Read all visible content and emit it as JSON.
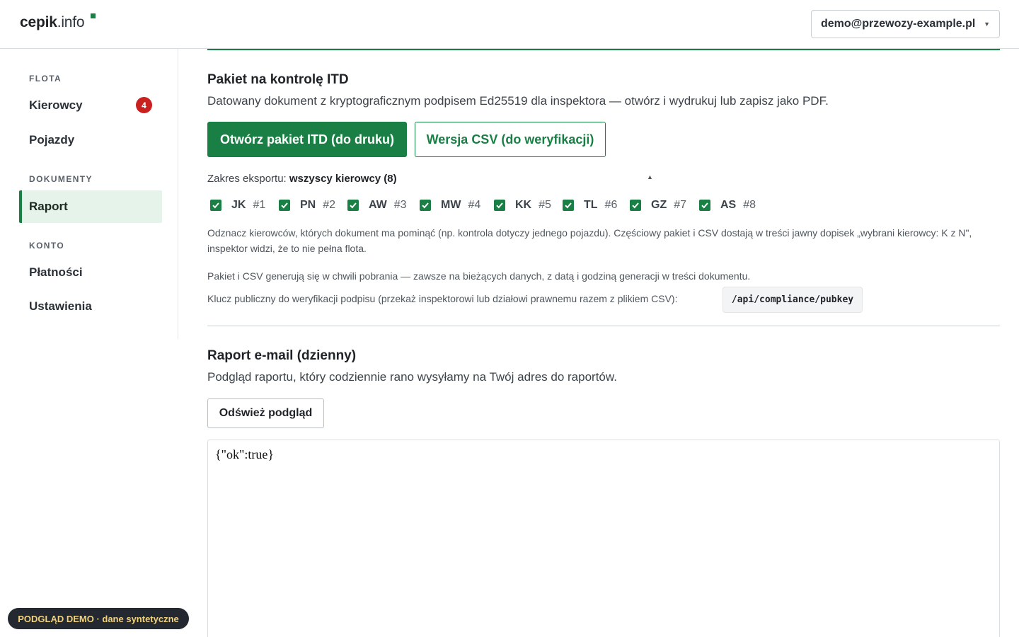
{
  "header": {
    "logo_name": "cepik",
    "logo_tld": ".info",
    "user_email": "demo@przewozy-example.pl"
  },
  "sidebar": {
    "sections": [
      {
        "label": "FLOTA"
      },
      {
        "label": "DOKUMENTY"
      },
      {
        "label": "KONTO"
      }
    ],
    "items": [
      {
        "label": "Kierowcy",
        "badge": "4"
      },
      {
        "label": "Pojazdy"
      },
      {
        "label": "Raport",
        "active": true
      },
      {
        "label": "Płatności"
      },
      {
        "label": "Ustawienia"
      }
    ]
  },
  "itd": {
    "title": "Pakiet na kontrolę ITD",
    "description": "Datowany dokument z kryptograficznym podpisem Ed25519 dla inspektora — otwórz i wydrukuj lub zapisz jako PDF.",
    "primary_button": "Otwórz pakiet ITD (do druku)",
    "csv_button": "Wersja CSV (do weryfikacji)",
    "scope_label": "Zakres eksportu:",
    "scope_value": "wszyscy kierowcy (8)",
    "drivers": [
      {
        "initials": "JK",
        "num": "#1",
        "checked": true
      },
      {
        "initials": "PN",
        "num": "#2",
        "checked": true
      },
      {
        "initials": "AW",
        "num": "#3",
        "checked": true
      },
      {
        "initials": "MW",
        "num": "#4",
        "checked": true
      },
      {
        "initials": "KK",
        "num": "#5",
        "checked": true
      },
      {
        "initials": "TL",
        "num": "#6",
        "checked": true
      },
      {
        "initials": "GZ",
        "num": "#7",
        "checked": true
      },
      {
        "initials": "AS",
        "num": "#8",
        "checked": true
      }
    ],
    "note_1": "Odznacz kierowców, których dokument ma pominąć (np. kontrola dotyczy jednego pojazdu). Częściowy pakiet i CSV dostają w treści jawny dopisek „wybrani kierowcy: K z N\", inspektor widzi, że to nie pełna flota.",
    "note_2": "Pakiet i CSV generują się w chwili pobrania — zawsze na bieżących danych, z datą i godziną generacji w treści dokumentu.",
    "note_3": "Klucz publiczny do weryfikacji podpisu (przekaż inspektorowi lub działowi prawnemu razem z plikiem CSV):",
    "pubkey_path": "/api/compliance/pubkey"
  },
  "email_report": {
    "title": "Raport e-mail (dzienny)",
    "description": "Podgląd raportu, który codziennie rano wysyłamy na Twój adres do raportów.",
    "refresh_button": "Odśwież podgląd",
    "preview_content": "{\"ok\":true}"
  },
  "demo_badge": "PODGLĄD DEMO · dane syntetyczne",
  "colors": {
    "accent": "#1a7f45",
    "badge": "#c8211f",
    "active_bg": "#e6f3ea"
  }
}
